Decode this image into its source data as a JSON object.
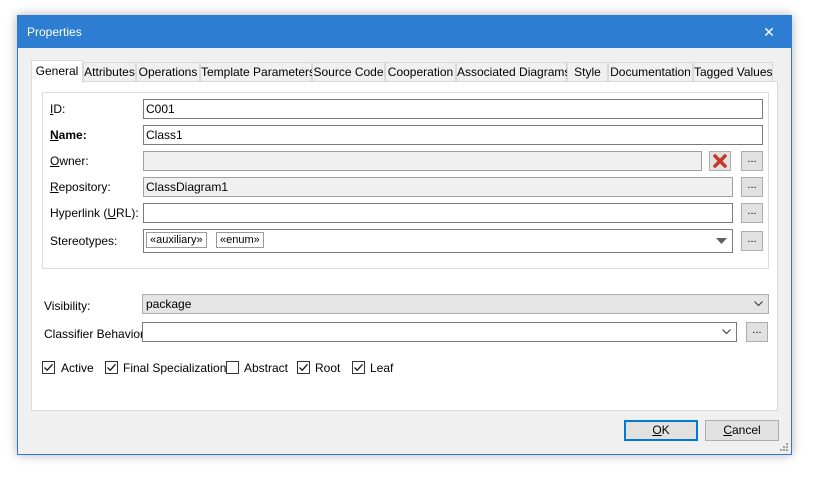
{
  "dialog": {
    "title": "Properties"
  },
  "tabs": [
    "General",
    "Attributes",
    "Operations",
    "Template Parameters",
    "Source Code",
    "Cooperation",
    "Associated Diagrams",
    "Style",
    "Documentation",
    "Tagged Values"
  ],
  "fields": {
    "id": {
      "label_u": "I",
      "label_rest": "D:",
      "value": "C001"
    },
    "name": {
      "label_u": "N",
      "label_rest": "ame:",
      "value": "Class1"
    },
    "owner": {
      "label_u": "O",
      "label_rest": "wner:",
      "value": ""
    },
    "repository": {
      "label_u": "R",
      "label_rest": "epository:",
      "value": "ClassDiagram1"
    },
    "hyperlink": {
      "label_pre": "Hyperlink (",
      "label_u": "U",
      "label_rest": "RL):",
      "value": ""
    },
    "stereotypes": {
      "label": "Stereotypes:",
      "items": [
        "«auxiliary»",
        "«enum»"
      ]
    },
    "visibility": {
      "label": "Visibility:",
      "value": "package"
    },
    "classifier_behavior": {
      "label": "Classifier Behavior:",
      "value": ""
    }
  },
  "browse_label": "...",
  "checkboxes": [
    {
      "label": "Active",
      "checked": true
    },
    {
      "label": "Final Specialization",
      "checked": true
    },
    {
      "label": "Abstract",
      "checked": false
    },
    {
      "label": "Root",
      "checked": true
    },
    {
      "label": "Leaf",
      "checked": true
    }
  ],
  "buttons": {
    "ok": {
      "label_u": "O",
      "label_rest": "K"
    },
    "cancel": {
      "label_u": "C",
      "label_rest": "ancel"
    }
  },
  "colors": {
    "titlebar": "#2d7dd2",
    "accent": "#0078d7",
    "delete_icon": "#c0392b"
  }
}
